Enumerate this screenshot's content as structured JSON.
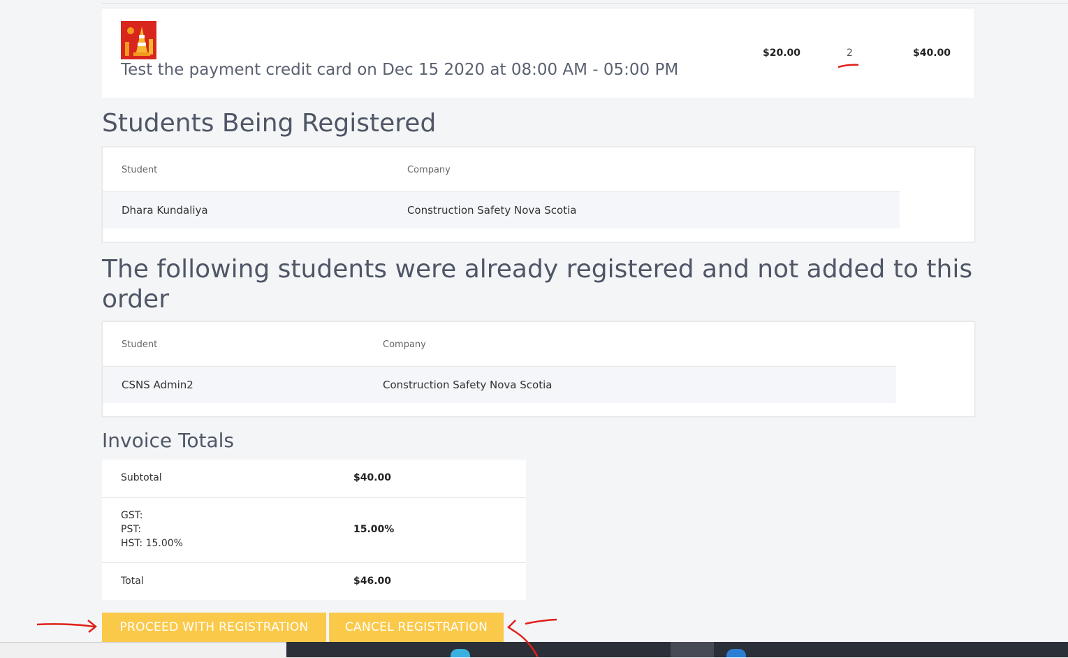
{
  "item": {
    "title": "Test the payment credit card on Dec 15 2020 at 08:00 AM - 05:00 PM",
    "price": "$20.00",
    "quantity": "2",
    "line_total": "$40.00"
  },
  "students_section": {
    "heading": "Students Being Registered",
    "columns": [
      "Student",
      "Company"
    ],
    "rows": [
      {
        "student": "Dhara Kundaliya",
        "company": "Construction Safety Nova Scotia"
      }
    ]
  },
  "already_section": {
    "heading": "The following students were already registered and not added to this order",
    "columns": [
      "Student",
      "Company"
    ],
    "rows": [
      {
        "student": "CSNS Admin2",
        "company": "Construction Safety Nova Scotia"
      }
    ]
  },
  "invoice": {
    "heading": "Invoice Totals",
    "subtotal_label": "Subtotal",
    "subtotal_value": "$40.00",
    "tax_lines": [
      "GST:",
      "PST:",
      "HST: 15.00%"
    ],
    "tax_value": "15.00%",
    "total_label": "Total",
    "total_value": "$46.00"
  },
  "buttons": {
    "proceed": "PROCEED WITH REGISTRATION",
    "cancel": "CANCEL REGISTRATION"
  },
  "colors": {
    "button": "#fbc94a",
    "annotation": "#e0201a",
    "page_bg": "#f4f5f7"
  }
}
